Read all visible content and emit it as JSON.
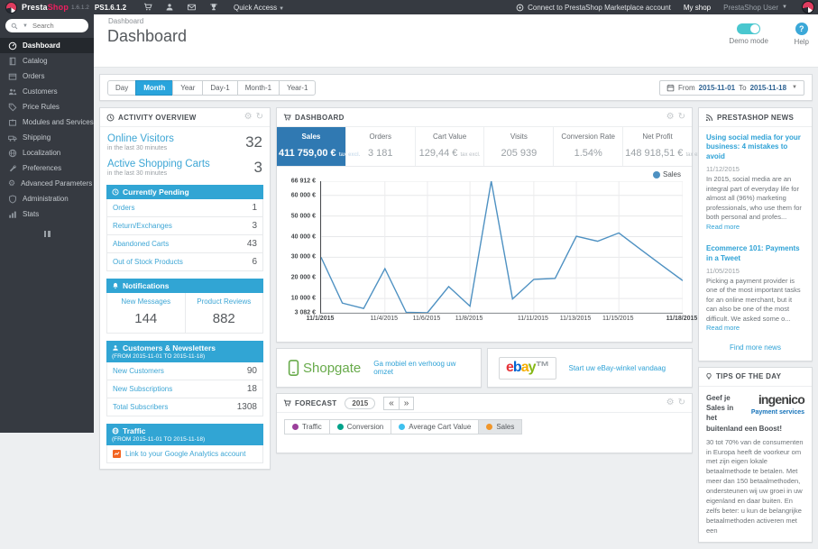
{
  "topbar": {
    "brand": {
      "presta": "Presta",
      "shop": "Shop",
      "version": "1.6.1.2",
      "ps_version": "PS1.6.1.2"
    },
    "quick_access": "Quick Access",
    "marketplace_link": "Connect to PrestaShop Marketplace account",
    "my_shop": "My shop",
    "user_menu": "PrestaShop User",
    "avatar_label": "PrestaShop"
  },
  "sidebar": {
    "search_placeholder": "Search",
    "items": [
      {
        "label": "Dashboard",
        "active": true
      },
      {
        "label": "Catalog"
      },
      {
        "label": "Orders"
      },
      {
        "label": "Customers"
      },
      {
        "label": "Price Rules"
      },
      {
        "label": "Modules and Services"
      },
      {
        "label": "Shipping"
      },
      {
        "label": "Localization"
      },
      {
        "label": "Preferences"
      },
      {
        "label": "Advanced Parameters"
      },
      {
        "label": "Administration"
      },
      {
        "label": "Stats"
      }
    ]
  },
  "header": {
    "breadcrumb": "Dashboard",
    "title": "Dashboard",
    "demo_mode": "Demo mode",
    "help": "Help"
  },
  "toolbar": {
    "ranges": [
      "Day",
      "Month",
      "Year",
      "Day-1",
      "Month-1",
      "Year-1"
    ],
    "active_range": "Month",
    "date_range": {
      "from_label": "From",
      "from": "2015-11-01",
      "to_label": "To",
      "to": "2015-11-18"
    }
  },
  "activity": {
    "title": "ACTIVITY OVERVIEW",
    "online_visitors": {
      "label": "Online Visitors",
      "sub": "in the last 30 minutes",
      "value": "32"
    },
    "active_carts": {
      "label": "Active Shopping Carts",
      "sub": "in the last 30 minutes",
      "value": "3"
    },
    "pending": {
      "title": "Currently Pending",
      "rows": [
        [
          "Orders",
          "1"
        ],
        [
          "Return/Exchanges",
          "3"
        ],
        [
          "Abandoned Carts",
          "43"
        ],
        [
          "Out of Stock Products",
          "6"
        ]
      ]
    },
    "notifications": {
      "title": "Notifications",
      "cols": [
        {
          "label": "New Messages",
          "value": "144"
        },
        {
          "label": "Product Reviews",
          "value": "882"
        }
      ]
    },
    "customers": {
      "title": "Customers & Newsletters",
      "subtitle": "(FROM 2015-11-01 TO 2015-11-18)",
      "rows": [
        [
          "New Customers",
          "90"
        ],
        [
          "New Subscriptions",
          "18"
        ],
        [
          "Total Subscribers",
          "1308"
        ]
      ]
    },
    "traffic": {
      "title": "Traffic",
      "subtitle": "(FROM 2015-11-01 TO 2015-11-18)",
      "link": "Link to your Google Analytics account"
    }
  },
  "dashboard_panel": {
    "title": "DASHBOARD",
    "kpis": [
      {
        "label": "Sales",
        "value": "411 759,00 €",
        "suffix": "tax excl.",
        "active": true
      },
      {
        "label": "Orders",
        "value": "3 181"
      },
      {
        "label": "Cart Value",
        "value": "129,44 €",
        "suffix": "tax excl."
      },
      {
        "label": "Visits",
        "value": "205 939"
      },
      {
        "label": "Conversion Rate",
        "value": "1.54%"
      },
      {
        "label": "Net Profit",
        "value": "148 918,51 €",
        "suffix": "tax excl."
      }
    ]
  },
  "chart_data": {
    "type": "line",
    "title": "Sales",
    "legend_position": "top-right",
    "grid": true,
    "x": [
      "11/1/2015",
      "11/2/2015",
      "11/3/2015",
      "11/4/2015",
      "11/5/2015",
      "11/6/2015",
      "11/7/2015",
      "11/8/2015",
      "11/9/2015",
      "11/10/2015",
      "11/11/2015",
      "11/12/2015",
      "11/13/2015",
      "11/14/2015",
      "11/15/2015",
      "11/16/2015",
      "11/17/2015",
      "11/18/2015"
    ],
    "series": [
      {
        "name": "Sales",
        "color": "#4e91c2",
        "values": [
          30000,
          7800,
          5200,
          24500,
          3300,
          3082,
          15800,
          6300,
          66912,
          9800,
          19300,
          19800,
          40200,
          37800,
          41800,
          34000,
          26300,
          18700
        ]
      }
    ],
    "ylim": [
      3082,
      66912
    ],
    "y_ticks": [
      {
        "v": 66912,
        "label": "66 912 €"
      },
      {
        "v": 60000,
        "label": "60 000 €"
      },
      {
        "v": 50000,
        "label": "50 000 €"
      },
      {
        "v": 40000,
        "label": "40 000 €"
      },
      {
        "v": 30000,
        "label": "30 000 €"
      },
      {
        "v": 20000,
        "label": "20 000 €"
      },
      {
        "v": 10000,
        "label": "10 000 €"
      },
      {
        "v": 3082,
        "label": "3 082 €"
      }
    ],
    "x_ticks": [
      {
        "day": 1,
        "label": "11/1/2015",
        "bold": true
      },
      {
        "day": 4,
        "label": "11/4/2015"
      },
      {
        "day": 6,
        "label": "11/6/2015"
      },
      {
        "day": 8,
        "label": "11/8/2015"
      },
      {
        "day": 11,
        "label": "11/11/2015"
      },
      {
        "day": 13,
        "label": "11/13/2015"
      },
      {
        "day": 15,
        "label": "11/15/2015"
      },
      {
        "day": 18,
        "label": "11/18/2015",
        "bold": true
      }
    ]
  },
  "banners": {
    "shopgate": {
      "logo_text": "Shopgate",
      "link": "Ga mobiel en verhoog uw omzet"
    },
    "ebay": {
      "letters": [
        "e",
        "b",
        "a",
        "y"
      ],
      "link": "Start uw eBay-winkel vandaag"
    }
  },
  "forecast": {
    "title": "FORECAST",
    "year": "2015",
    "legend": [
      {
        "label": "Traffic",
        "color": "#9b3f9b"
      },
      {
        "label": "Conversion",
        "color": "#00a28a"
      },
      {
        "label": "Average Cart Value",
        "color": "#3fc1ef"
      },
      {
        "label": "Sales",
        "color": "#f0962a",
        "active": true
      }
    ]
  },
  "news": {
    "title": "PRESTASHOP NEWS",
    "articles": [
      {
        "title": "Using social media for your business: 4 mistakes to avoid",
        "date": "11/12/2015",
        "excerpt": "In 2015, social media are an integral part of everyday life for almost all (96%) marketing professionals, who use them for both personal and profes...",
        "read_more": "Read more"
      },
      {
        "title": "Ecommerce 101: Payments in a Tweet",
        "date": "11/05/2015",
        "excerpt": "Picking a payment provider is one of the most important tasks for an online merchant, but it can also be one of the most difficult. We asked some o...",
        "read_more": "Read more"
      }
    ],
    "more_link": "Find more news"
  },
  "tips": {
    "title": "TIPS OF THE DAY",
    "heading": "Geef je Sales in het buitenland een Boost!",
    "logo": {
      "name": "ingenico",
      "tagline": "Payment services"
    },
    "body": "30 tot 70% van de consumenten in Europa heeft de voorkeur om met zijn eigen lokale betaalmethode te betalen. Met meer dan 150 betaalmethoden, ondersteunen wij uw groei in uw eigenland en daar buiten. En zelfs beter: u kun de belangrijke betaalmethoden activeren met een"
  },
  "colors": {
    "accent_blue": "#31a5d4",
    "kpi_active_bg": "#3079b2",
    "active_range_bg": "#29a4dc",
    "toggle_teal": "#49c7cf",
    "chart_line": "#4e91c2",
    "shopgate_green": "#67aa4a",
    "ingenico_blue": "#1472ba",
    "ga_orange": "#f26522",
    "ebay_letters": [
      "#e53238",
      "#0064d2",
      "#f5af02",
      "#86b817"
    ]
  }
}
